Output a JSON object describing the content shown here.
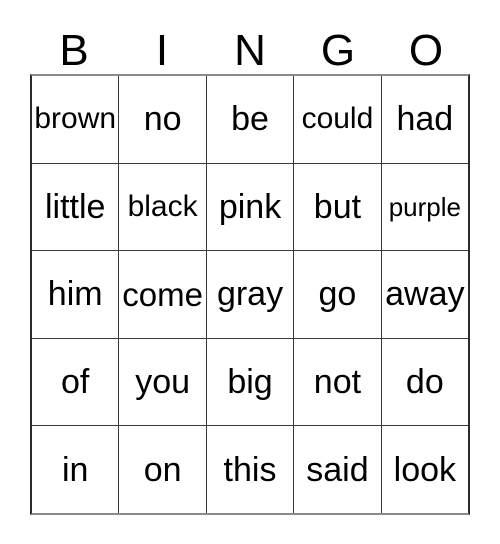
{
  "card": {
    "title": "BINGO",
    "header_letters": [
      "B",
      "I",
      "N",
      "G",
      "O"
    ],
    "colors": {
      "background": "#ffffff",
      "text": "#000000",
      "grid_line": "#3a3a3a",
      "outer_frame": "#8a8a8a"
    },
    "grid": {
      "columns": 5,
      "rows": 5,
      "free_space": false,
      "cells": [
        [
          "brown",
          "no",
          "be",
          "could",
          "had"
        ],
        [
          "little",
          "black",
          "pink",
          "but",
          "purple"
        ],
        [
          "him",
          "come",
          "gray",
          "go",
          "away"
        ],
        [
          "of",
          "you",
          "big",
          "not",
          "do"
        ],
        [
          "in",
          "on",
          "this",
          "said",
          "look"
        ]
      ]
    }
  }
}
